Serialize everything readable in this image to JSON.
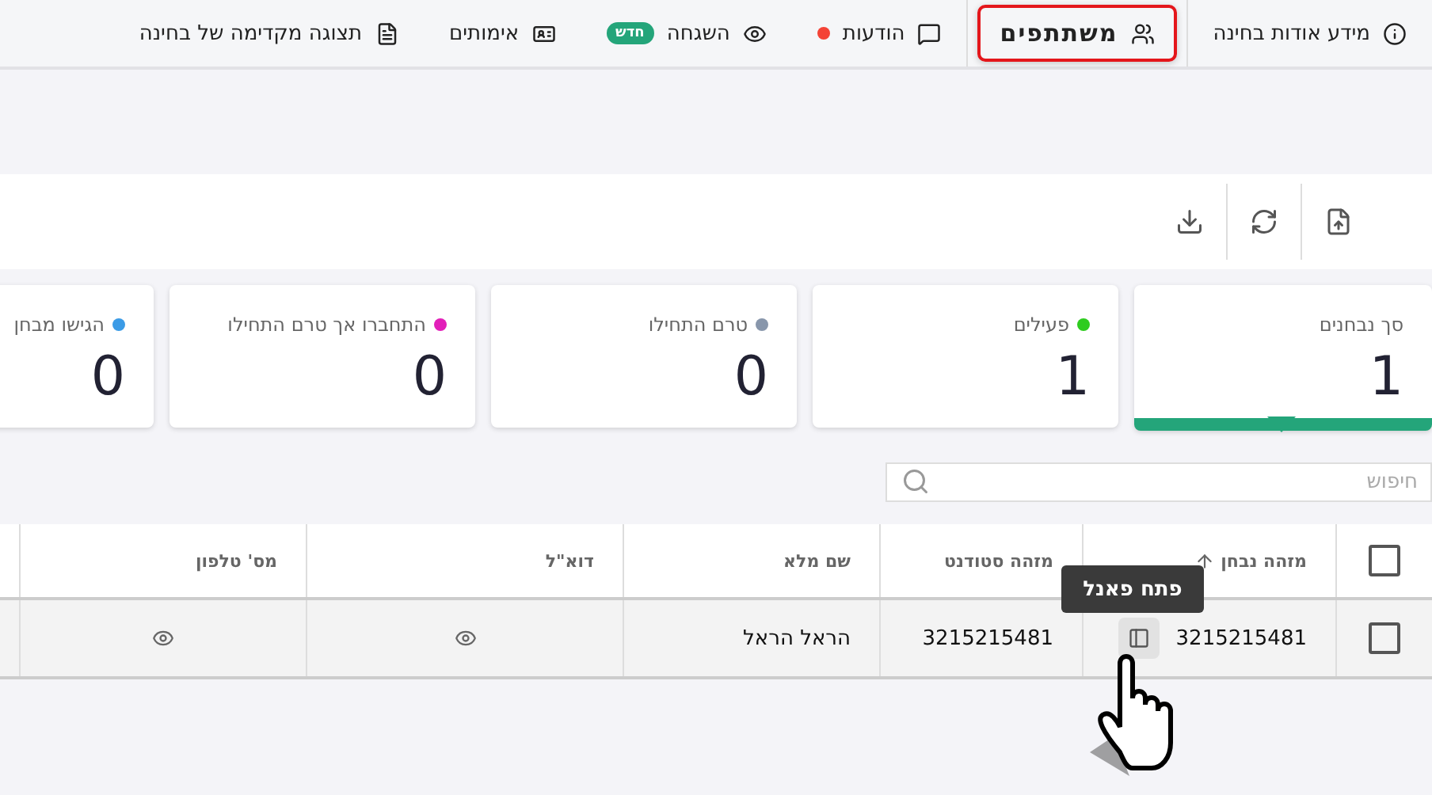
{
  "tabs": [
    {
      "label": "מידע אודות בחינה",
      "selected": false,
      "unread": false
    },
    {
      "label": "משתתפים",
      "selected": true,
      "unread": false
    },
    {
      "label": "הודעות",
      "selected": false,
      "unread": true
    },
    {
      "label": "השגחה",
      "selected": false,
      "unread": false,
      "badge": "חדש"
    },
    {
      "label": "אימותים",
      "selected": false,
      "unread": false
    },
    {
      "label": "תצוגה מקדימה של בחינה",
      "selected": false,
      "unread": false
    }
  ],
  "cards": [
    {
      "label": "סך נבחנים",
      "value": "1",
      "selected": true
    },
    {
      "label": "פעילים",
      "value": "1",
      "color": "#2ecc1f",
      "selected": false
    },
    {
      "label": "טרם התחילו",
      "value": "0",
      "color": "#8896ab",
      "selected": false
    },
    {
      "label": "התחברו אך טרם התחילו",
      "value": "0",
      "color": "#e21fb9",
      "selected": false
    },
    {
      "label": "הגישו מבחן",
      "value": "0",
      "color": "#3b9be6",
      "selected": false
    }
  ],
  "search": {
    "placeholder": "חיפוש"
  },
  "table": {
    "header_checkbox": {
      "checked": false
    },
    "columns": [
      {
        "label": "מזהה נבחן",
        "sorted": true
      },
      {
        "label": "מזהה סטודנט",
        "sorted": false
      },
      {
        "label": "שם מלא",
        "sorted": false
      },
      {
        "label": "דוא\"ל",
        "sorted": false
      },
      {
        "label": "מס' טלפון",
        "sorted": false
      }
    ],
    "rows": [
      {
        "checked": false,
        "cells": [
          {
            "kind": "text",
            "text": "3215215481"
          },
          {
            "kind": "text",
            "text": "3215215481"
          },
          {
            "kind": "text",
            "text": "הראל הראל"
          },
          {
            "kind": "hidden"
          },
          {
            "kind": "hidden"
          }
        ]
      }
    ]
  },
  "tooltip": "פתח פאנל"
}
